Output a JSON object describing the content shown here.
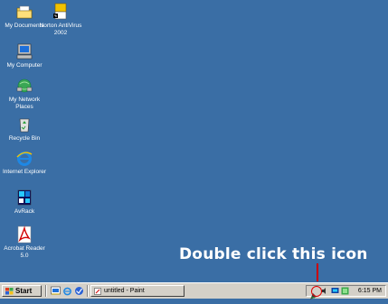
{
  "desktop": {
    "background": "#3a6ea5",
    "icons": [
      {
        "label": "My Documents",
        "icon": "folder-icon"
      },
      {
        "label": "Norton AntiVirus 2002",
        "icon": "norton-antivirus-icon"
      },
      {
        "label": "My Computer",
        "icon": "computer-icon"
      },
      {
        "label": "My Network Places",
        "icon": "network-icon"
      },
      {
        "label": "Recycle Bin",
        "icon": "recycle-bin-icon"
      },
      {
        "label": "Internet Explorer",
        "icon": "internet-explorer-icon"
      },
      {
        "label": "AvRack",
        "icon": "avrack-icon"
      },
      {
        "label": "Acrobat Reader 5.0",
        "icon": "acrobat-reader-icon"
      }
    ]
  },
  "annotation": {
    "text": "Double click this icon",
    "color": "#cc0000"
  },
  "taskbar": {
    "start_label": "Start",
    "quick_launch": [
      "show-desktop-icon",
      "internet-explorer-icon",
      "outlook-express-icon"
    ],
    "tasks": [
      {
        "label": "untitled - Paint",
        "icon": "paint-icon"
      }
    ],
    "tray_icons": [
      "highlighted-tray-icon",
      "volume-icon",
      "network-tray-icon",
      "monitor-tray-icon"
    ],
    "clock": "6:15 PM"
  }
}
